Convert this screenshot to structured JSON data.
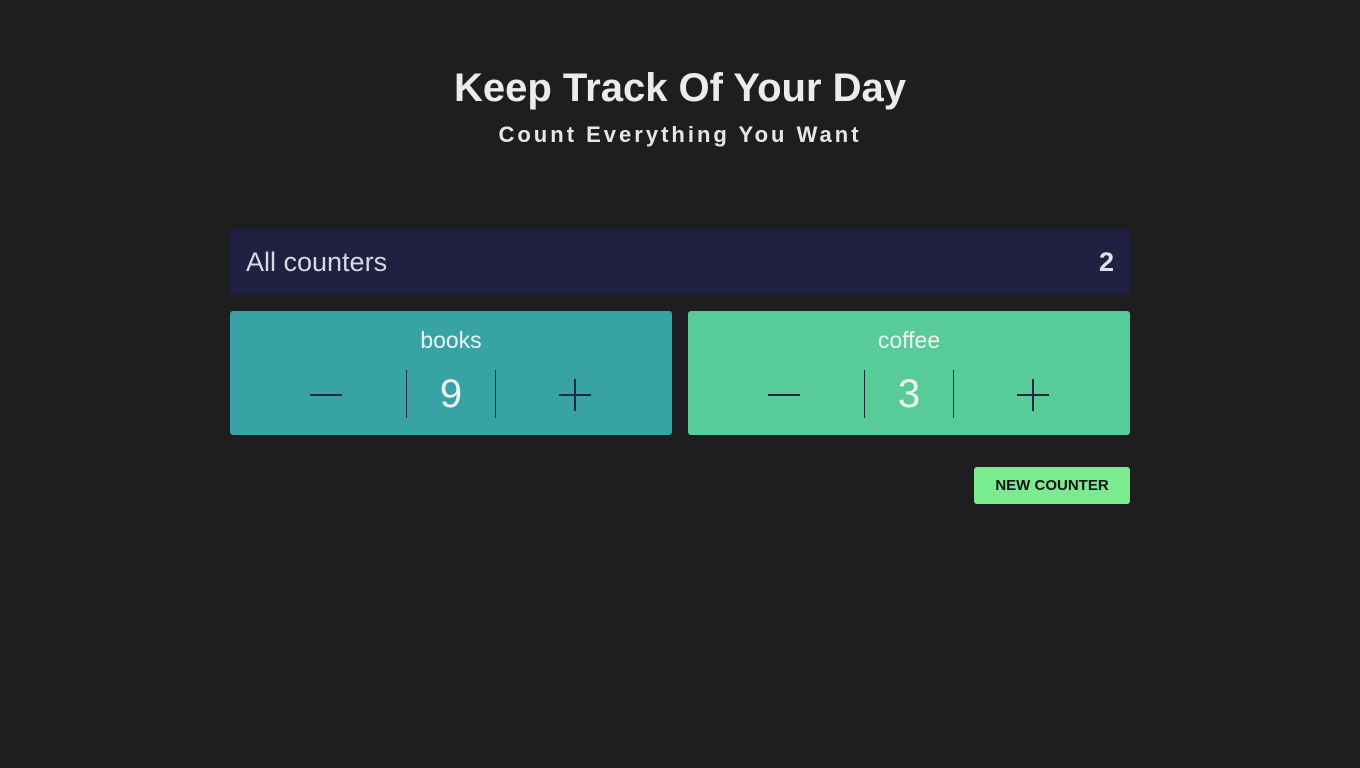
{
  "header": {
    "title": "Keep Track Of Your Day",
    "subtitle": "Count Everything You Want"
  },
  "summary": {
    "label": "All counters",
    "count": "2",
    "background": "#202043"
  },
  "counters": [
    {
      "name": "books",
      "value": "9",
      "color": "#38a3a5",
      "decrement_icon": "minus-icon",
      "increment_icon": "plus-icon"
    },
    {
      "name": "coffee",
      "value": "3",
      "color": "#57cc99",
      "decrement_icon": "minus-icon",
      "increment_icon": "plus-icon"
    }
  ],
  "actions": {
    "new_counter_label": "NEW COUNTER",
    "new_counter_color": "#7aeb8f"
  }
}
